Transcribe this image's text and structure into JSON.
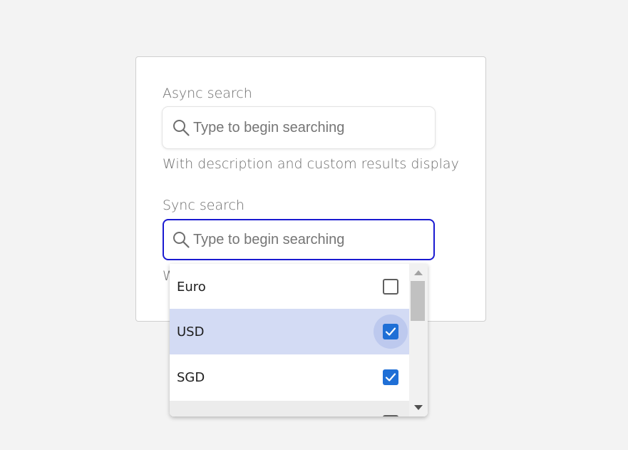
{
  "async_search": {
    "label": "Async search",
    "placeholder": "Type to begin searching",
    "description": "With description and custom results display"
  },
  "sync_search": {
    "label": "Sync search",
    "placeholder": "Type to begin searching",
    "description_visible": "W"
  },
  "dropdown": {
    "options": [
      {
        "label": "Euro",
        "checked": false
      },
      {
        "label": "USD",
        "checked": true
      },
      {
        "label": "SGD",
        "checked": true
      }
    ]
  },
  "colors": {
    "focus_border": "#1a1ad1",
    "checkbox_checked": "#1f6fd6",
    "highlight_row": "#d3dbf4"
  },
  "icons": {
    "search": "search-icon",
    "check": "check-icon"
  }
}
